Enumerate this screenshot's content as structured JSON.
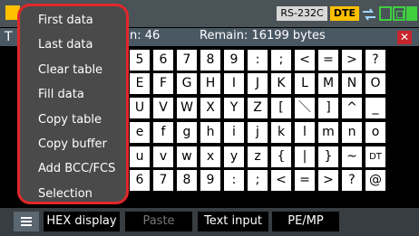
{
  "status_bar": {
    "interface_badge": "RS-232C",
    "mode_badge": "DTE",
    "accent_color": "#ffc000",
    "icons": [
      "connection-arrow-icon",
      "panel-toggle-icon",
      "stop-icon",
      "power-icon"
    ]
  },
  "info_bar": {
    "title_initial": "T",
    "count_text": "n: 46",
    "remain_text": "Remain: 16199 bytes",
    "close_glyph": "✕",
    "close_color": "#c7252d"
  },
  "keyboard_rows": [
    [
      "5",
      "6",
      "7",
      "8",
      "9",
      ":",
      ";",
      "<",
      "=",
      ">",
      "?"
    ],
    [
      "E",
      "F",
      "G",
      "H",
      "I",
      "J",
      "K",
      "L",
      "M",
      "N",
      "O"
    ],
    [
      "U",
      "V",
      "W",
      "X",
      "Y",
      "Z",
      "[",
      "＼",
      "]",
      "^",
      "_"
    ],
    [
      "e",
      "f",
      "g",
      "h",
      "i",
      "j",
      "k",
      "l",
      "m",
      "n",
      "o"
    ],
    [
      "u",
      "v",
      "w",
      "x",
      "y",
      "z",
      "{",
      "|",
      "}",
      "~",
      "DT"
    ],
    [
      "6",
      "7",
      "8",
      "9",
      ":",
      ";",
      "<",
      "=",
      ">",
      "?",
      "@"
    ]
  ],
  "menu": {
    "border_color": "#e1272a",
    "items": [
      {
        "label": "First data"
      },
      {
        "label": "Last data"
      },
      {
        "label": "Clear table"
      },
      {
        "label": "Fill data"
      },
      {
        "label": "Copy table"
      },
      {
        "label": "Copy buffer"
      },
      {
        "label": "Add BCC/FCS"
      },
      {
        "label": "Selection"
      }
    ]
  },
  "bottom_bar": {
    "menu_icon": "hamburger-menu-icon",
    "softkeys": [
      {
        "label": "HEX display",
        "enabled": true
      },
      {
        "label": "Paste",
        "enabled": false
      },
      {
        "label": "Text input",
        "enabled": true
      },
      {
        "label": "PE/MP",
        "enabled": true
      }
    ]
  }
}
